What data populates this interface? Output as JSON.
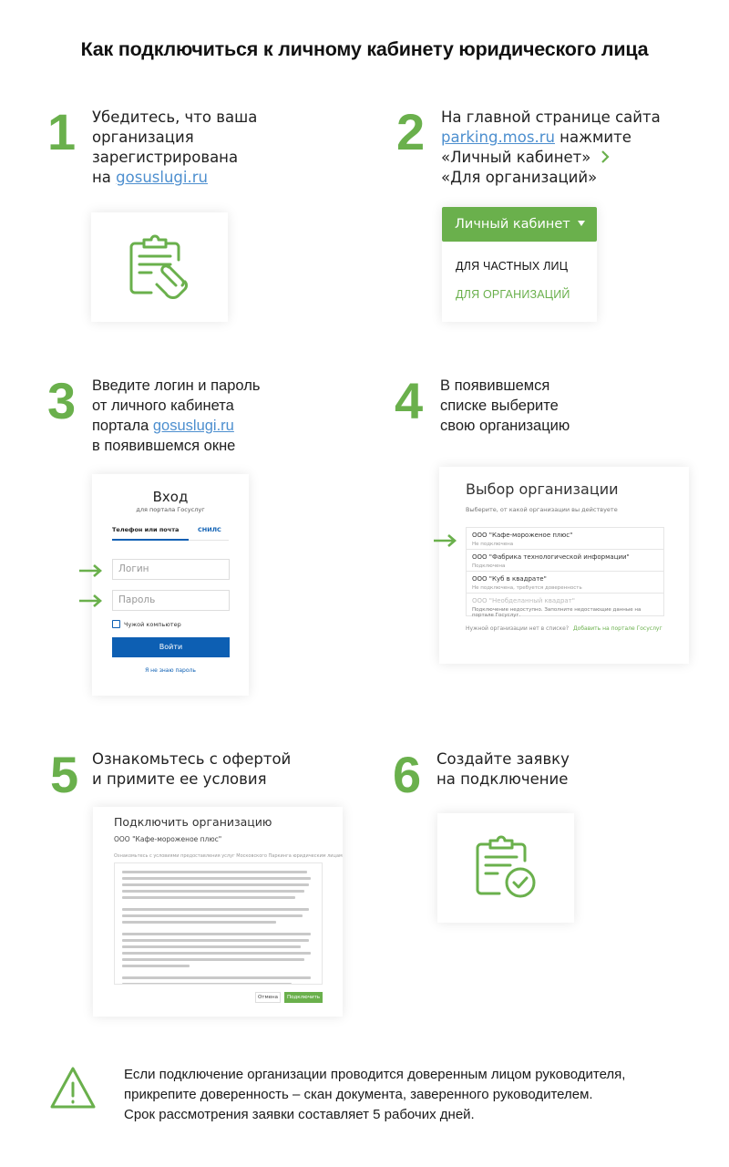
{
  "title": "Как подключиться к личному кабинету юридического лица",
  "colors": {
    "accent_green": "#6ab04c",
    "link_blue": "#4d8fcf",
    "gosuslugi_blue": "#0d5fb3"
  },
  "steps": [
    {
      "number": "1",
      "lines": [
        "Убедитесь, что ваша",
        "организация",
        "зарегистрирована"
      ],
      "last_prefix": "на ",
      "link": "gosuslugi.ru",
      "icon": "clipboard-hand-icon"
    },
    {
      "number": "2",
      "line1": "На главной странице сайта",
      "link": "parking.mos.ru",
      "line2_suffix": " нажмите",
      "line3": "«Личный кабинет»",
      "line4": "«Для организаций»",
      "dropdown": {
        "button": "Личный кабинет",
        "items": [
          "ДЛЯ ЧАСТНЫХ ЛИЦ",
          "ДЛЯ ОРГАНИЗАЦИЙ"
        ]
      }
    },
    {
      "number": "3",
      "line1": "Введите логин и пароль",
      "line2": "от личного кабинета",
      "line3_prefix": "портала ",
      "link": "gosuslugi.ru",
      "line4": "в появившемся окне",
      "login": {
        "title": "Вход",
        "subtitle": "для портала Госуслуг",
        "tabs": [
          "Телефон или почта",
          "СНИЛС"
        ],
        "login_placeholder": "Логин",
        "password_placeholder": "Пароль",
        "checkbox": "Чужой компьютер",
        "submit": "Войти",
        "forgot": "Я не знаю пароль"
      }
    },
    {
      "number": "4",
      "lines": [
        "В появившемся",
        "списке выберите",
        "свою организацию"
      ],
      "org_select": {
        "title": "Выбор организации",
        "subtitle": "Выберите, от какой организации вы действуете",
        "orgs": [
          {
            "name": "ООО \"Кафе-мороженое плюс\"",
            "status": "Не подключена"
          },
          {
            "name": "ООО \"Фабрика технологической информации\"",
            "status": "Подключена"
          },
          {
            "name": "ООО \"Куб в квадрате\"",
            "status": "Не подключена, требуется доверенность"
          },
          {
            "name": "ООО \"Необделанный квадрат\"",
            "status": "Подключение недоступно. Заполните недостающие данные на портале Госуслуг."
          }
        ],
        "footer_text": "Нужной организации нет в списке?",
        "footer_link": "Добавить на портале Госуслуг"
      }
    },
    {
      "number": "5",
      "lines": [
        "Ознакомьтесь с офертой",
        "и примите ее условия"
      ],
      "offer": {
        "title": "Подключить организацию",
        "org": "ООО \"Кафе-мороженое плюс\"",
        "hint": "Ознакомьтесь с условиями предоставления услуг Московского Паркинга юридическим лицам",
        "cancel": "Отмена",
        "submit": "Подключить"
      }
    },
    {
      "number": "6",
      "lines": [
        "Создайте заявку",
        "на подключение"
      ],
      "icon": "clipboard-check-icon"
    }
  ],
  "note": {
    "icon": "warning-icon",
    "lines": [
      "Если подключение организации проводится доверенным лицом руководителя,",
      "прикрепите доверенность – скан документа, заверенного руководителем.",
      "Срок рассмотрения заявки составляет 5 рабочих дней."
    ]
  }
}
